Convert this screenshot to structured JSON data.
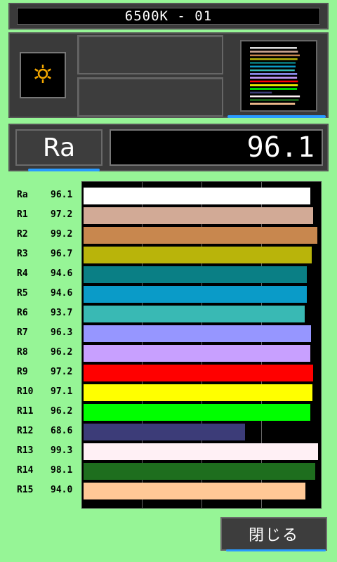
{
  "header": {
    "title": "6500K - 01"
  },
  "mode": {
    "icon": "sun-icon",
    "accent": "#f5a800"
  },
  "ra": {
    "label": "Ra",
    "value": "96.1"
  },
  "buttons": {
    "close_label": "閉じる"
  },
  "colors": {
    "accent_blue": "#2a9bff"
  },
  "chart_data": {
    "type": "bar",
    "orientation": "horizontal",
    "categories": [
      "Ra",
      "R1",
      "R2",
      "R3",
      "R4",
      "R5",
      "R6",
      "R7",
      "R8",
      "R9",
      "R10",
      "R11",
      "R12",
      "R13",
      "R14",
      "R15"
    ],
    "values": [
      96.1,
      97.2,
      99.2,
      96.7,
      94.6,
      94.6,
      93.7,
      96.3,
      96.2,
      97.2,
      97.1,
      96.2,
      68.6,
      99.3,
      98.1,
      94.0
    ],
    "value_labels": [
      "96.1",
      "97.2",
      "99.2",
      "96.7",
      "94.6",
      "94.6",
      "93.7",
      "96.3",
      "96.2",
      "97.2",
      "97.1",
      "96.2",
      "68.6",
      "99.3",
      "98.1",
      "94.0"
    ],
    "bar_colors": [
      "#ffffff",
      "#d2aa96",
      "#c8874e",
      "#b9b40a",
      "#0a7f85",
      "#0a9bc8",
      "#39b9b4",
      "#9696ff",
      "#c8a0ff",
      "#ff0000",
      "#ffff00",
      "#00ff00",
      "#3c3c78",
      "#fff0f5",
      "#1e6e1e",
      "#ffc896"
    ],
    "xlim": [
      0,
      100
    ],
    "grid": true
  }
}
